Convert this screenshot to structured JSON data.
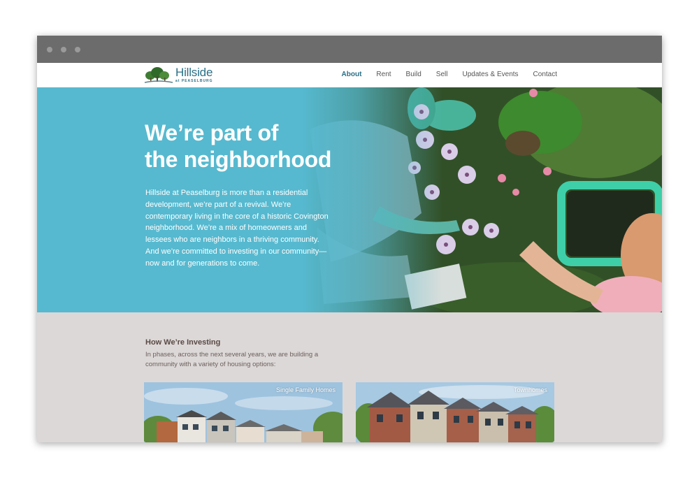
{
  "colors": {
    "accent": "#56b9cf",
    "brand": "#2a6f87",
    "section_bg": "#dcd8d8"
  },
  "window": {
    "controls": [
      "close-dot",
      "minimize-dot",
      "zoom-dot"
    ]
  },
  "header": {
    "logo": {
      "name": "Hillside",
      "subtitle": "at PEASELBURG",
      "icon": "tree-icon"
    },
    "nav": [
      {
        "label": "About",
        "active": true
      },
      {
        "label": "Rent"
      },
      {
        "label": "Build"
      },
      {
        "label": "Sell"
      },
      {
        "label": "Updates & Events"
      },
      {
        "label": "Contact"
      }
    ]
  },
  "hero": {
    "title_line1": "We’re part of",
    "title_line2": "the neighborhood",
    "body": "Hillside at Peaselburg is more than a residential development, we’re part of a revival. We’re contemporary living in the core of a historic Covington neighborhood. We’re a mix of homeowners and lessees who are neighbors in a thriving community. And we’re committed to investing in our community—now and for generations to come."
  },
  "investing": {
    "heading": "How We’re Investing",
    "subtitle": "In phases, across the next several years, we are building a community with a variety of housing options:",
    "cards": [
      {
        "label": "Single Family Homes"
      },
      {
        "label": "Townhomes"
      }
    ]
  }
}
